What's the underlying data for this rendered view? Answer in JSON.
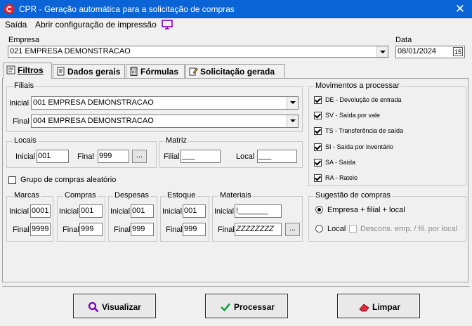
{
  "window": {
    "title": "CPR - Geração automática para a solicitação de compras",
    "close_glyph": "✕"
  },
  "menu": {
    "exit": "Saída",
    "print_config": "Abrir configuração de impressão"
  },
  "empresa": {
    "label": "Empresa",
    "value": "021 EMPRESA DEMONSTRACAO"
  },
  "data": {
    "label": "Data",
    "value": "08/01/2024",
    "calendar_day": "15"
  },
  "tabs": [
    {
      "label": "Filtros",
      "icon": "filter-icon"
    },
    {
      "label": "Dados gerais",
      "icon": "book-icon"
    },
    {
      "label": "Fórmulas",
      "icon": "calculator-icon"
    },
    {
      "label": "Solicitação gerada",
      "icon": "document-pen-icon"
    }
  ],
  "filiais": {
    "label": "Filiais",
    "inicial_label": "Inicial",
    "inicial_value": "001 EMPRESA DEMONSTRACAO",
    "final_label": "Final",
    "final_value": "004 EMPRESA DEMONSTRACAO"
  },
  "locais": {
    "label": "Locais",
    "inicial_label": "Inicial",
    "inicial_value": "001",
    "final_label": "Final",
    "final_value": "999",
    "lookup": "..."
  },
  "matriz": {
    "label": "Matriz",
    "filial_label": "Filial",
    "filial_value": "___",
    "local_label": "Local",
    "local_value": "___"
  },
  "grupo_aleatorio": {
    "label": "Grupo de compras aleatório",
    "checked": false
  },
  "marcas": {
    "label": "Marcas",
    "inicial_label": "Inicial",
    "inicial_value": "0001",
    "final_label": "Final",
    "final_value": "9999"
  },
  "compras": {
    "label": "Compras",
    "inicial_label": "Inicial",
    "inicial_value": "001",
    "final_label": "Final",
    "final_value": "999"
  },
  "despesas": {
    "label": "Despesas",
    "inicial_label": "Inicial",
    "inicial_value": "001",
    "final_label": "Final",
    "final_value": "999"
  },
  "estoque": {
    "label": "Estoque",
    "inicial_label": "Inicial",
    "inicial_value": "001",
    "final_label": "Final",
    "final_value": "999"
  },
  "materiais": {
    "label": "Materiais",
    "inicial_label": "Inicial",
    "inicial_value": "!_______",
    "final_label": "Final",
    "final_value": "ZZZZZZZZ",
    "lookup": "..."
  },
  "movimentos": {
    "label": "Movimentos a processar",
    "items": [
      {
        "label": "DE - Devolução de entrada",
        "checked": true
      },
      {
        "label": "SV - Saída por vale",
        "checked": true
      },
      {
        "label": "TS - Transferência de saída",
        "checked": true
      },
      {
        "label": "SI - Saída por inventário",
        "checked": true
      },
      {
        "label": "SA - Saída",
        "checked": true
      },
      {
        "label": "RA - Rateio",
        "checked": true
      }
    ]
  },
  "sugestao": {
    "label": "Sugestão de compras",
    "option1": "Empresa + filial + local",
    "option2": "Local",
    "desconsiderar": "Descons. emp. / fil. por local",
    "selected": "Empresa + filial + local"
  },
  "buttons": {
    "visualizar": "Visualizar",
    "processar": "Processar",
    "limpar": "Limpar"
  },
  "colors": {
    "titlebar": "#0a64d6",
    "accent_purple": "#8000c0"
  }
}
